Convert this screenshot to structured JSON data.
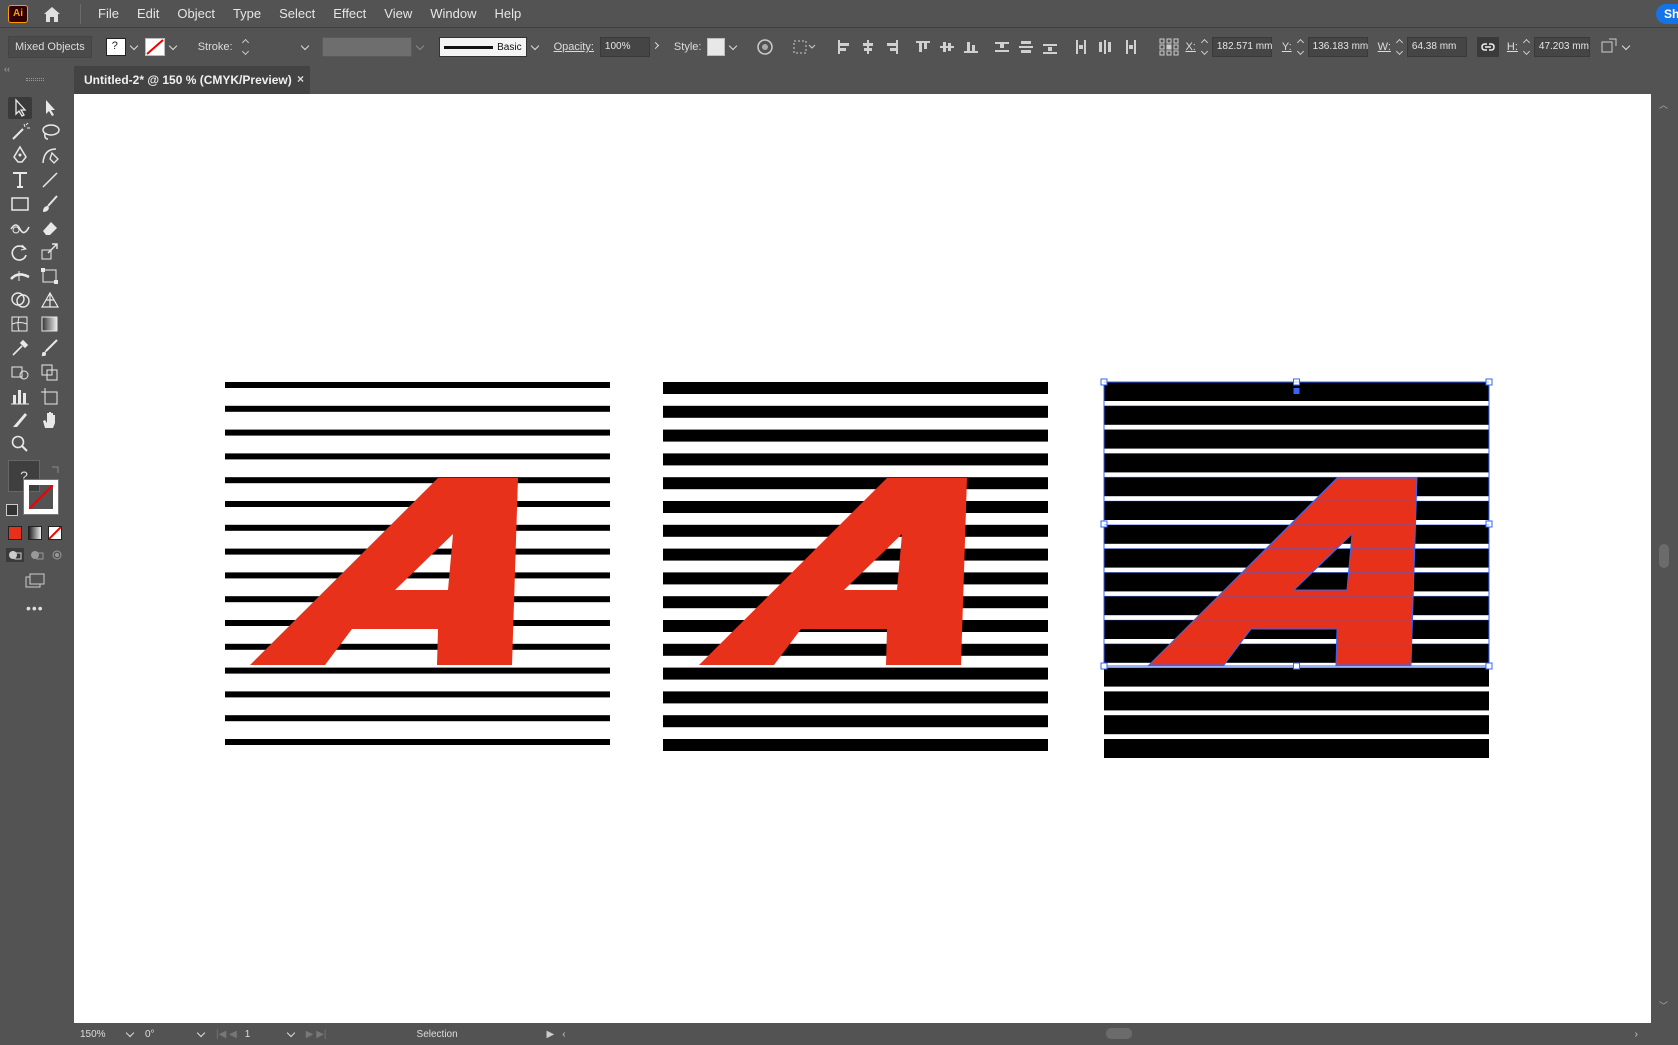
{
  "app": {
    "logo": "Ai",
    "share_label": "Sh"
  },
  "menu": [
    "File",
    "Edit",
    "Object",
    "Type",
    "Select",
    "Effect",
    "View",
    "Window",
    "Help"
  ],
  "control_bar": {
    "selection_label": "Mixed Objects",
    "stroke_label": "Stroke:",
    "brush_label": "Basic",
    "opacity_label": "Opacity:",
    "opacity_value": "100%",
    "style_label": "Style:",
    "x_label": "X:",
    "x_value": "182.571 mm",
    "y_label": "Y:",
    "y_value": "136.183 mm",
    "w_label": "W:",
    "w_value": "64.38 mm",
    "h_label": "H:",
    "h_value": "47.203 mm"
  },
  "document_tab": {
    "title": "Untitled-2* @ 150 % (CMYK/Preview)",
    "close": "×"
  },
  "status_bar": {
    "zoom": "150%",
    "rotation": "0°",
    "artboard": "1",
    "tool_name": "Selection"
  },
  "tools": [
    "selection",
    "direct-selection",
    "magic-wand",
    "lasso",
    "pen",
    "curvature",
    "type",
    "line",
    "rectangle",
    "paintbrush",
    "shaper",
    "eraser",
    "rotate",
    "scale",
    "width",
    "free-transform",
    "shape-builder",
    "perspective-grid",
    "mesh",
    "gradient",
    "eyedropper",
    "blend",
    "symbol-sprayer",
    "column-graph",
    "artboard",
    "slice",
    "hand",
    "zoom"
  ],
  "fill_stroke": {
    "unknown_label": "?"
  },
  "colors": {
    "accent_red": "#e8311a",
    "selection_blue": "#3366ff",
    "ui_bg": "#535353"
  },
  "artwork": {
    "glyph": "A"
  }
}
